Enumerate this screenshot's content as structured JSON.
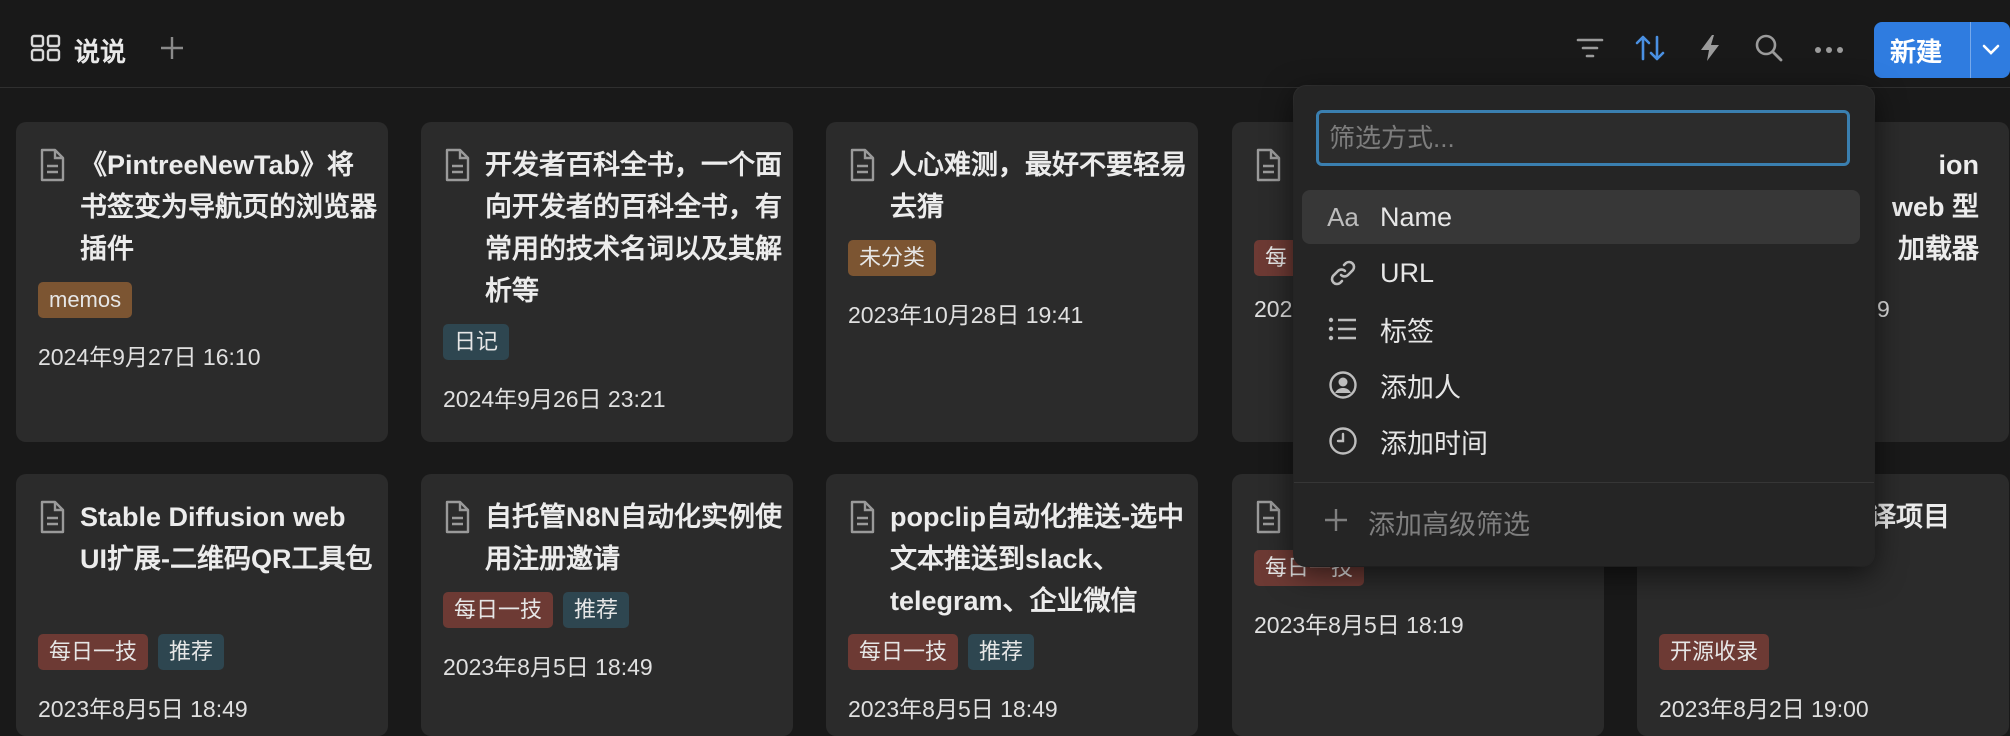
{
  "header": {
    "view_name": "说说",
    "new_button_label": "新建"
  },
  "toolbar_icons": [
    "filter-icon",
    "sort-icon",
    "lightning-icon",
    "search-icon",
    "more-icon"
  ],
  "accent_color": "#2f7ce0",
  "cards": [
    {
      "title": "《PintreeNewTab》将书签变为导航页的浏览器插件",
      "tags": [
        {
          "label": "memos",
          "color": "brown"
        }
      ],
      "date": "2024年9月27日 16:10"
    },
    {
      "title": " 开发者百科全书，一个面向开发者的百科全书，有常用的技术名词以及其解析等",
      "tags": [
        {
          "label": "日记",
          "color": "blue"
        }
      ],
      "date": "2024年9月26日 23:21"
    },
    {
      "title": "人心难测，最好不要轻易去猜",
      "tags": [
        {
          "label": "未分类",
          "color": "brown"
        }
      ],
      "date": "2023年10月28日 19:41"
    },
    {
      "title": "",
      "tags": [
        {
          "label": "每",
          "color": "red"
        }
      ],
      "date": "202"
    },
    {
      "title": "ion web 型加载器",
      "tags": [],
      "date": "9"
    },
    {
      "title": "Stable Diffusion web UI扩展-二维码QR工具包",
      "tags": [
        {
          "label": "每日一技",
          "color": "red"
        },
        {
          "label": "推荐",
          "color": "blue"
        }
      ],
      "date": "2023年8月5日 18:49"
    },
    {
      "title": "自托管N8N自动化实例使用注册邀请",
      "tags": [
        {
          "label": "每日一技",
          "color": "red"
        },
        {
          "label": "推荐",
          "color": "blue"
        }
      ],
      "date": "2023年8月5日 18:49"
    },
    {
      "title": "popclip自动化推送-选中文本推送到slack、telegram、企业微信",
      "tags": [
        {
          "label": "每日一技",
          "color": "red"
        },
        {
          "label": "推荐",
          "color": "blue"
        }
      ],
      "date": "2023年8月5日 18:49"
    },
    {
      "title": "",
      "tags": [
        {
          "label": "每日一技",
          "color": "red"
        }
      ],
      "date": "2023年8月5日 18:19"
    },
    {
      "title": "的 文汉化翻 译项目",
      "tags": [
        {
          "label": "开源收录",
          "color": "red"
        }
      ],
      "date": "2023年8月2日 19:00"
    }
  ],
  "filter_menu": {
    "placeholder": "筛选方式...",
    "options": [
      {
        "icon": "text-aa-icon",
        "label": "Name"
      },
      {
        "icon": "link-icon",
        "label": "URL"
      },
      {
        "icon": "list-icon",
        "label": "标签"
      },
      {
        "icon": "person-icon",
        "label": "添加人"
      },
      {
        "icon": "clock-icon",
        "label": "添加时间"
      }
    ],
    "advanced_label": "添加高级筛选"
  }
}
